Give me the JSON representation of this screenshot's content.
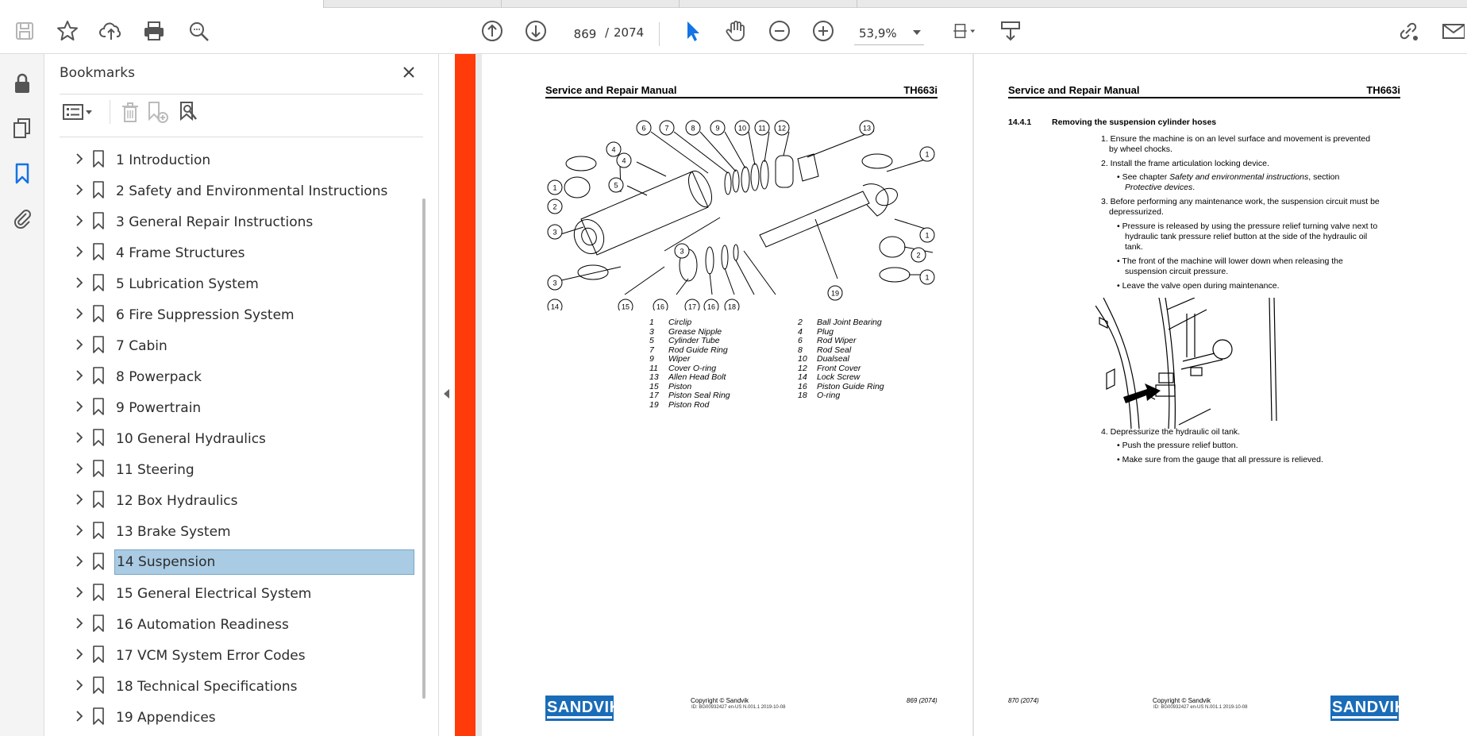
{
  "toolbar": {
    "current_page": "869",
    "page_separator": "/",
    "total_pages": "2074",
    "zoom": "53,9%"
  },
  "bookmarks": {
    "title": "Bookmarks",
    "items": [
      {
        "label": "1 Introduction"
      },
      {
        "label": "2 Safety and Environmental Instructions"
      },
      {
        "label": "3 General Repair Instructions"
      },
      {
        "label": "4 Frame Structures"
      },
      {
        "label": "5 Lubrication System"
      },
      {
        "label": "6 Fire Suppression System"
      },
      {
        "label": "7 Cabin"
      },
      {
        "label": "8 Powerpack"
      },
      {
        "label": "9 Powertrain"
      },
      {
        "label": "10 General Hydraulics"
      },
      {
        "label": "11 Steering"
      },
      {
        "label": "12 Box Hydraulics"
      },
      {
        "label": "13 Brake System"
      },
      {
        "label": "14 Suspension"
      },
      {
        "label": "15 General Electrical System"
      },
      {
        "label": "16 Automation Readiness"
      },
      {
        "label": "17 VCM System Error Codes"
      },
      {
        "label": "18 Technical Specifications"
      },
      {
        "label": "19 Appendices"
      }
    ],
    "selected_index": 13
  },
  "page_left": {
    "header_left": "Service and Repair Manual",
    "header_right": "TH663i",
    "diagram_callouts": [
      "6",
      "7",
      "8",
      "9",
      "10",
      "11",
      "12",
      "13",
      "1",
      "4",
      "5",
      "1",
      "2",
      "3",
      "4",
      "3",
      "2",
      "1",
      "3",
      "1",
      "14",
      "15",
      "16",
      "17",
      "16",
      "18",
      "19"
    ],
    "parts_left": [
      {
        "num": "1",
        "name": "Circlip"
      },
      {
        "num": "3",
        "name": "Grease Nipple"
      },
      {
        "num": "5",
        "name": "Cylinder Tube"
      },
      {
        "num": "7",
        "name": "Rod Guide Ring"
      },
      {
        "num": "9",
        "name": "Wiper"
      },
      {
        "num": "11",
        "name": "Cover O-ring"
      },
      {
        "num": "13",
        "name": "Allen Head Bolt"
      },
      {
        "num": "15",
        "name": "Piston"
      },
      {
        "num": "17",
        "name": "Piston Seal Ring"
      },
      {
        "num": "19",
        "name": "Piston Rod"
      }
    ],
    "parts_right": [
      {
        "num": "2",
        "name": "Ball Joint Bearing"
      },
      {
        "num": "4",
        "name": "Plug"
      },
      {
        "num": "6",
        "name": "Rod Wiper"
      },
      {
        "num": "8",
        "name": "Rod Seal"
      },
      {
        "num": "10",
        "name": "Dualseal"
      },
      {
        "num": "12",
        "name": "Front Cover"
      },
      {
        "num": "14",
        "name": "Lock Screw"
      },
      {
        "num": "16",
        "name": "Piston Guide Ring"
      },
      {
        "num": "18",
        "name": "O-ring"
      }
    ],
    "logo": "SANDVIK",
    "copyright": "Copyright © Sandvik",
    "doc_id": "ID: BG00932427 en-US N.001.1 2019-10-08",
    "page_label": "869 (2074)"
  },
  "page_right": {
    "header_left": "Service and Repair Manual",
    "header_right": "TH663i",
    "section_number": "14.4.1",
    "section_title": "Removing the suspension cylinder hoses",
    "step1a": "1. Ensure the machine is on an level surface and movement is prevented",
    "step1b": "by wheel chocks.",
    "step2": "2. Install the frame articulation locking device.",
    "step2_bullet_pre": "• See chapter ",
    "step2_bullet_it1": "Safety and environmental instructions",
    "step2_bullet_mid": ", section",
    "step2_bullet_it2": "Protective devices",
    "step2_bullet_end": ".",
    "step3a": "3. Before performing any maintenance work, the suspension circuit must be",
    "step3b": "depressurized.",
    "step3_b1a": "• Pressure is released by using the pressure relief turning valve next to",
    "step3_b1b": "hydraulic tank pressure relief button at the side of the hydraulic oil",
    "step3_b1c": "tank.",
    "step3_b2a": "• The front of the machine will lower down when releasing the",
    "step3_b2b": "suspension circuit pressure.",
    "step3_b3": "• Leave the valve open during maintenance.",
    "step4": "4. Depressurize the hydraulic oil tank.",
    "step4_b1": "• Push the pressure relief button.",
    "step4_b2": "• Make sure from the gauge that all pressure is relieved.",
    "page_label": "870 (2074)",
    "copyright": "Copyright © Sandvik",
    "doc_id": "ID: BG00932427 en-US N.001.1 2019-10-08",
    "logo": "SANDVIK"
  },
  "colors": {
    "accent_blue": "#1473e6",
    "selected_bg": "#a9cbe3",
    "red_bar": "#ff3b0a",
    "sandvik_blue": "#1a6cb8"
  }
}
